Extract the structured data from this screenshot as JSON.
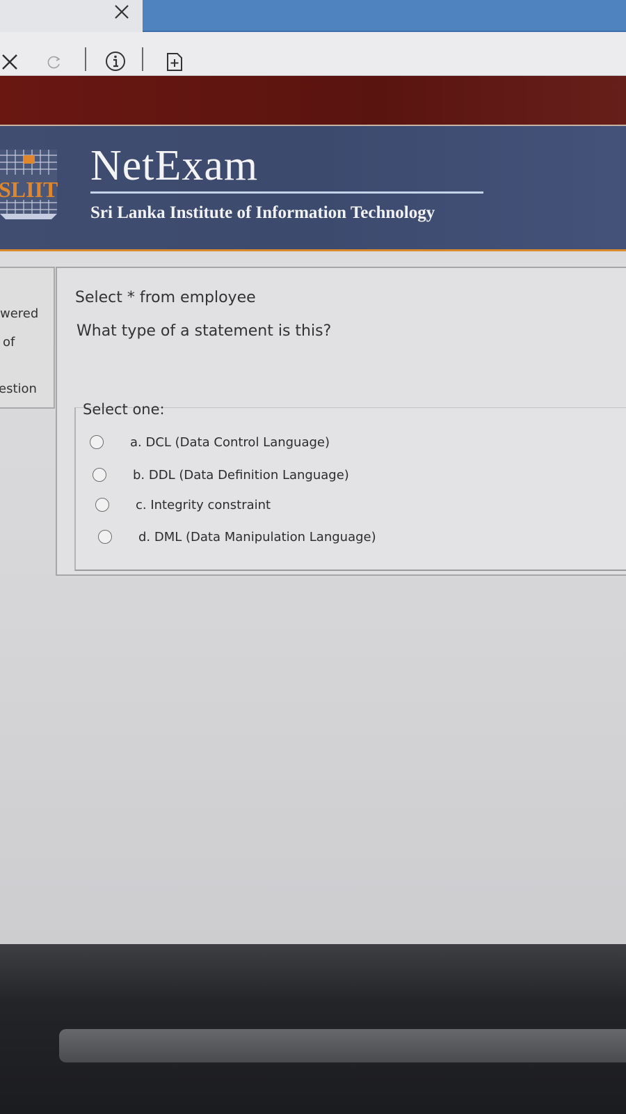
{
  "browser": {
    "tab_close_icon": "close-icon",
    "stop_icon": "close-icon",
    "reload_icon": "reload-icon",
    "info_icon": "info-icon",
    "new_tab_icon": "new-tab-icon",
    "active_tab_color": "#4f83bf"
  },
  "header": {
    "app_title": "NetExam",
    "institute_name": "Sri Lanka Institute of Information Technology",
    "logo_text": "SLIIT",
    "maroon_color": "#5a1410",
    "navy_color": "#3c4a6e",
    "accent_color": "#d98b2e"
  },
  "info_panel": {
    "line1": "wered",
    "line2": "of",
    "line3": "estion"
  },
  "question": {
    "line1": "Select * from employee",
    "line2": "What type of a statement is this?",
    "prompt": "Select one:",
    "options": [
      {
        "label": "a. DCL (Data Control Language)"
      },
      {
        "label": "b. DDL (Data Definition Language)"
      },
      {
        "label": "c. Integrity constraint"
      },
      {
        "label": "d. DML (Data Manipulation Language)"
      }
    ]
  }
}
